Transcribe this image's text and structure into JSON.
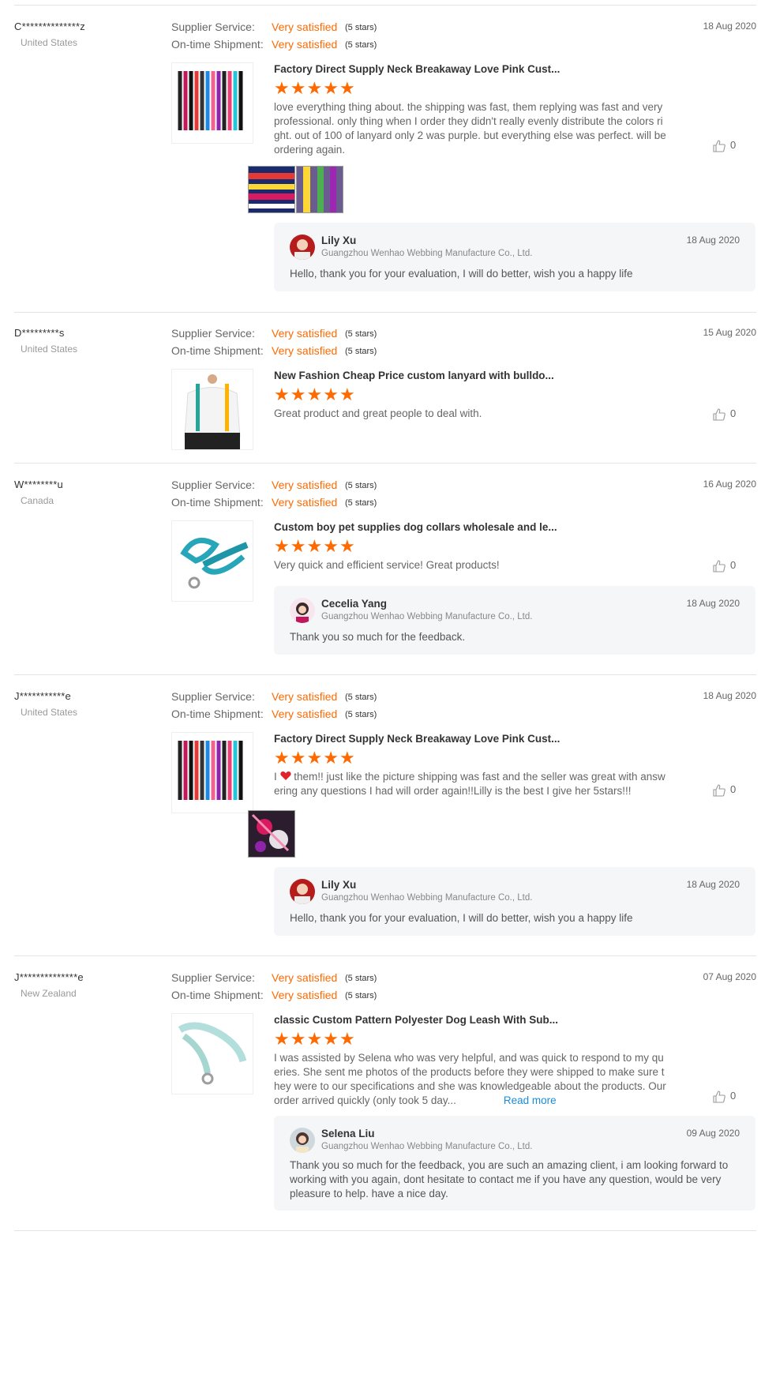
{
  "labels": {
    "supplier_service": "Supplier Service:",
    "ontime_shipment": "On-time Shipment:",
    "rating_value": "Very satisfied",
    "rating_stars": "(5 stars)"
  },
  "colors": {
    "accent": "#ff6a00",
    "link": "#1a8cd8",
    "reply_bg": "#f5f6f8"
  },
  "reviews": [
    {
      "name": "C**************z",
      "country": "United States",
      "date": "18 Aug 2020",
      "product_title": "Factory Direct Supply Neck Breakaway Love Pink Cust...",
      "rating": 5,
      "text": "love everything thing about. the shipping was fast, them replying was fast and very professional. only thing when I order they didn't really evenly distribute the colors right. out of 100 of lanyard only 2 was purple. but everything else was perfect. will be ordering again.",
      "likes": "0",
      "reply": {
        "name": "Lily Xu",
        "company": "Guangzhou Wenhao Webbing Manufacture Co., Ltd.",
        "date": "18 Aug 2020",
        "text": "Hello, thank you for your evaluation, I will do better, wish you a happy life"
      }
    },
    {
      "name": "D*********s",
      "country": "United States",
      "date": "15 Aug 2020",
      "product_title": "New Fashion Cheap Price custom lanyard with bulldo...",
      "rating": 5,
      "text": "Great product and great people to deal with.",
      "likes": "0"
    },
    {
      "name": "W********u",
      "country": "Canada",
      "date": "16 Aug 2020",
      "product_title": "Custom boy pet supplies dog collars wholesale and le...",
      "rating": 5,
      "text": "Very quick and efficient service! Great products!",
      "likes": "0",
      "reply": {
        "name": "Cecelia Yang",
        "company": "Guangzhou Wenhao Webbing Manufacture Co., Ltd.",
        "date": "18 Aug 2020",
        "text": "Thank you so much for the feedback."
      }
    },
    {
      "name": "J***********e",
      "country": "United States",
      "date": "18 Aug 2020",
      "product_title": "Factory Direct Supply Neck Breakaway Love Pink Cust...",
      "rating": 5,
      "text_before": "I ",
      "text": " them!! just like the picture shipping was fast and the seller was great with answering any questions I had will order again!!Lilly is the best I give her 5stars!!!",
      "likes": "0",
      "reply": {
        "name": "Lily Xu",
        "company": "Guangzhou Wenhao Webbing Manufacture Co., Ltd.",
        "date": "18 Aug 2020",
        "text": "Hello, thank you for your evaluation, I will do better, wish you a happy life"
      }
    },
    {
      "name": "J**************e",
      "country": "New Zealand",
      "date": "07 Aug 2020",
      "product_title": "classic Custom Pattern Polyester Dog Leash With Sub...",
      "rating": 5,
      "text": "I was assisted by Selena who was very helpful, and was quick to respond to my queries. She sent me photos of the products before they were shipped to make sure they were to our specifications and she was knowledgeable about the products. Our order arrived quickly (only took 5 day...",
      "read_more": "Read more",
      "likes": "0",
      "reply": {
        "name": "Selena Liu",
        "company": "Guangzhou Wenhao Webbing Manufacture Co., Ltd.",
        "date": "09 Aug 2020",
        "text": "Thank you so much for the feedback, you are such an amazing client, i am looking forward to working with you again, dont hesitate to contact me if you have any question, would be very pleasure to help. have a nice day."
      }
    }
  ]
}
